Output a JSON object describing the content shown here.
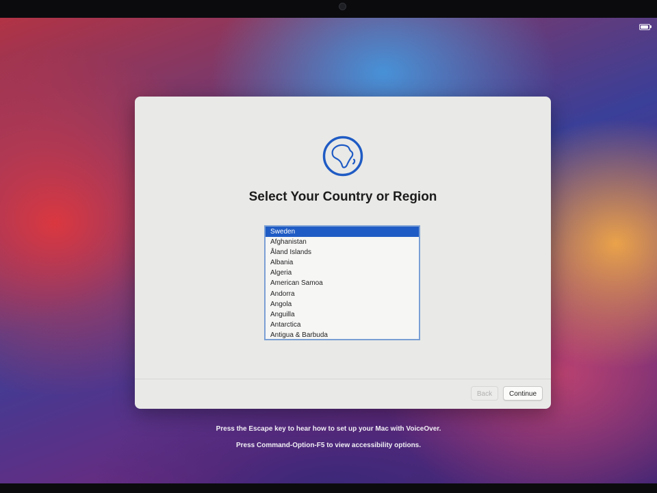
{
  "setup_window": {
    "title": "Select Your Country or Region",
    "icon": "globe-icon",
    "countries": [
      "Sweden",
      "Afghanistan",
      "Åland Islands",
      "Albania",
      "Algeria",
      "American Samoa",
      "Andorra",
      "Angola",
      "Anguilla",
      "Antarctica",
      "Antigua & Barbuda"
    ],
    "selected_country": "Sweden",
    "buttons": {
      "back_label": "Back",
      "continue_label": "Continue"
    }
  },
  "accessibility_hints": [
    "Press the Escape key to hear how to set up your Mac with VoiceOver.",
    "Press Command-Option-F5 to view accessibility options."
  ],
  "colors": {
    "accent": "#1f5bc4",
    "globe": "#1f5bc4",
    "window_bg": "#e9e9e7"
  }
}
